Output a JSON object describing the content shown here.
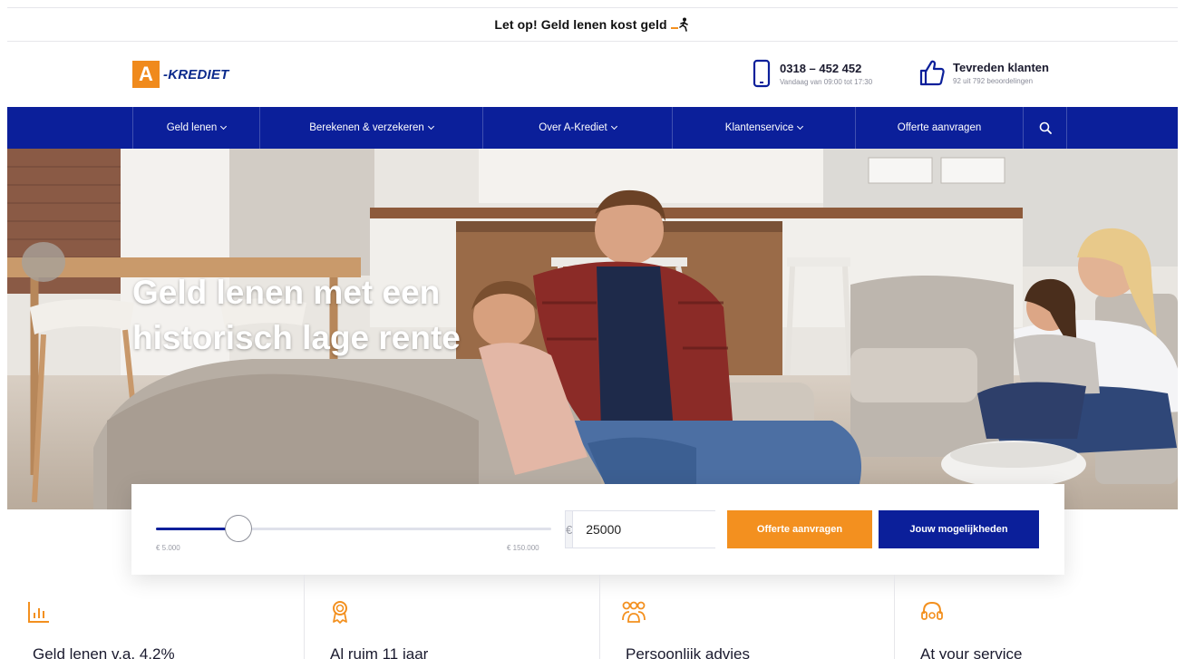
{
  "topbar": {
    "warning": "Let op! Geld lenen kost geld"
  },
  "header": {
    "logo_letter": "A",
    "logo_text": "-KREDIET",
    "phone": "0318 – 452 452",
    "phone_hours": "Vandaag van 09:00 tot 17:30",
    "reviews_title": "Tevreden klanten",
    "reviews_sub": "92 uit 792 beoordelingen"
  },
  "nav": {
    "items": [
      {
        "label": "Geld lenen"
      },
      {
        "label": "Berekenen & verzekeren"
      },
      {
        "label": "Over A-Krediet"
      },
      {
        "label": "Klantenservice"
      },
      {
        "label": "Offerte aanvragen"
      }
    ]
  },
  "hero": {
    "title_line1": "Geld lenen met een",
    "title_line2": "historisch lage rente"
  },
  "calculator": {
    "slider_min_label": "€ 5.000",
    "slider_max_label": "€ 150.000",
    "slider_fraction": 0.14,
    "currency": "€",
    "amount_value": "25000",
    "offerte_button": "Offerte aanvragen",
    "mogelijkheden_button": "Jouw mogelijkheden"
  },
  "features": [
    {
      "label": "Geld lenen v.a. 4,2%",
      "icon": "chart-icon"
    },
    {
      "label": "Al ruim 11 jaar",
      "icon": "award-icon"
    },
    {
      "label": "Persoonlijk advies",
      "icon": "people-icon"
    },
    {
      "label": "At your service",
      "icon": "headset-icon"
    }
  ],
  "colors": {
    "brand_blue": "#0b1f9a",
    "brand_orange": "#f3901f"
  }
}
